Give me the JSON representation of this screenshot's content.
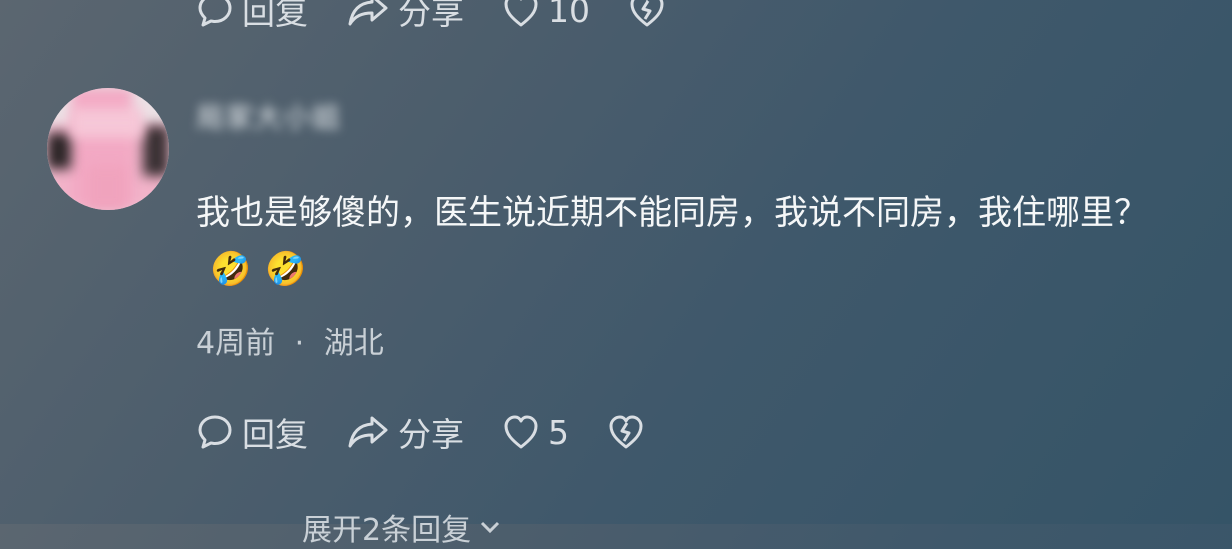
{
  "previous_comment": {
    "actions": {
      "reply_label": "回复",
      "share_label": "分享",
      "like_count": "10"
    }
  },
  "comment": {
    "username": "局家大小姐",
    "text": "我也是够傻的，医生说近期不能同房，我说不同房，我住哪里？",
    "emojis": [
      "🤣",
      "🤣"
    ],
    "time": "4周前",
    "separator": "·",
    "location": "湖北",
    "actions": {
      "reply_label": "回复",
      "share_label": "分享",
      "like_count": "5"
    },
    "expand_label": "展开2条回复"
  },
  "icons": {
    "reply": "speech-bubble-icon",
    "share": "share-arrow-icon",
    "like": "heart-icon",
    "dislike": "broken-heart-icon",
    "expand": "chevron-down-icon"
  }
}
